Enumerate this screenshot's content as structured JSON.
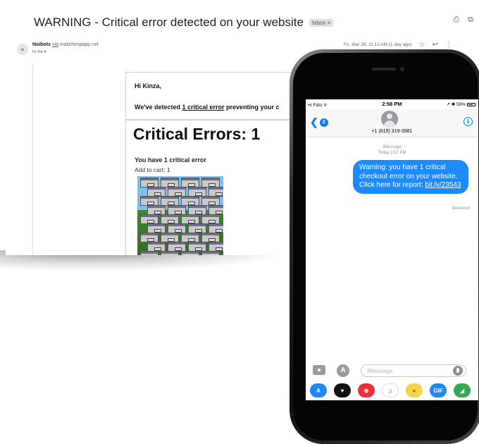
{
  "email": {
    "subject": "WARNING - Critical error detected on your website",
    "label_badge": "Inbox ×",
    "sender_name": "Noibots",
    "via_text": "via",
    "sender_address": "mailchimpapp.net",
    "to_line": "to me ▾",
    "date": "Fri, Mar 29, 11:13 AM (1 day ago)",
    "greeting": "Hi Kinza,",
    "detect_prefix": "We've detected ",
    "detect_link": "1 critical error",
    "detect_suffix": " preventing your c",
    "critical_title": "Critical Errors: 1",
    "have_errors": "You have 1 critical error",
    "add_to_cart": "Add to cart: 1",
    "icons": {
      "print": "print-icon",
      "open": "open-external-icon",
      "star": "star-icon",
      "reply": "reply-icon",
      "more": "more-vertical-icon"
    }
  },
  "phone": {
    "status": {
      "carrier": "Fido",
      "time": "2:58 PM",
      "battery": "59%"
    },
    "back_count": "2",
    "contact_number": "+1 (819) 319-3981",
    "imessage_label": "iMessage",
    "imessage_time": "Today 2:57 PM",
    "message_text": "Warning: you have 1 critical checkout error on your website. Click here for report: ",
    "message_link": "bit.ly/23543",
    "delivered": "Delivered",
    "input_placeholder": "iMessage",
    "apps": [
      {
        "name": "app-store",
        "color": "#1e88f5",
        "glyph": "A"
      },
      {
        "name": "digital-touch",
        "color": "#111111",
        "glyph": "♥"
      },
      {
        "name": "search-images",
        "color": "#e8303a",
        "glyph": "⊕"
      },
      {
        "name": "music",
        "color": "#ffffff",
        "glyph": "♫"
      },
      {
        "name": "animoji",
        "color": "#f3d54a",
        "glyph": "●"
      },
      {
        "name": "gif",
        "color": "#1e88f5",
        "glyph": "GIF"
      },
      {
        "name": "maps",
        "color": "#34a853",
        "glyph": "◢"
      }
    ]
  }
}
